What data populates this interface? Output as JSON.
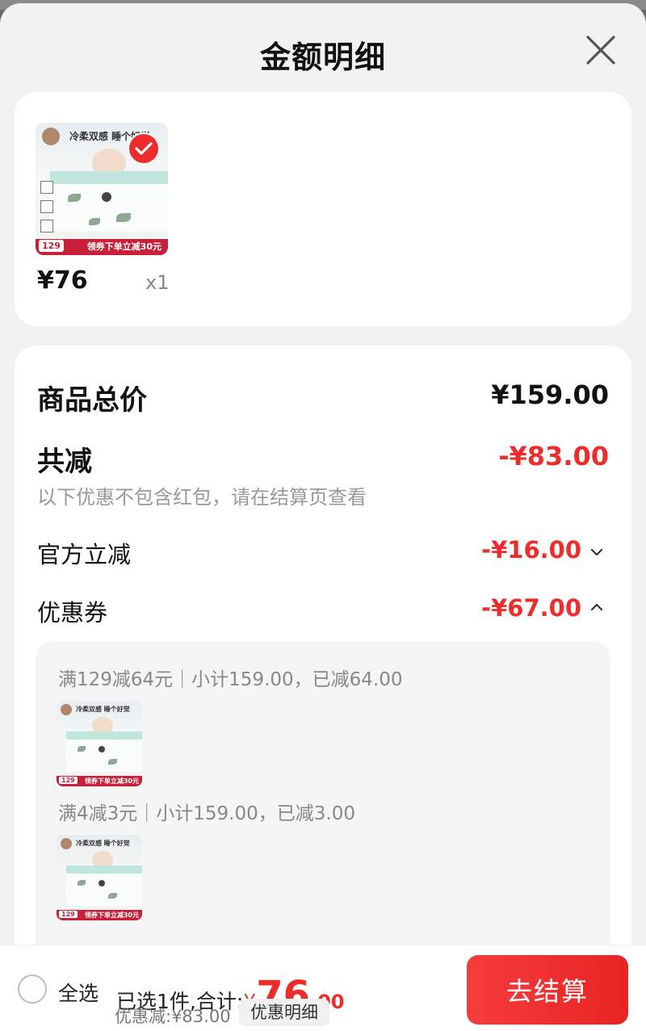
{
  "header": {
    "title": "金额明细"
  },
  "product": {
    "image_headline": "冷柔双感 睡个好觉",
    "image_promo": "领券下单立减30元",
    "image_price": "129",
    "price": "¥76",
    "quantity": "x1"
  },
  "summary_rows": {
    "total_label": "商品总价",
    "total_value": "¥159.00",
    "reduce_label": "共减",
    "reduce_value": "-¥83.00",
    "reduce_note": "以下优惠不包含红包，请在结算页查看",
    "official_label": "官方立减",
    "official_value": "-¥16.00",
    "coupon_label": "优惠券",
    "coupon_value": "-¥67.00"
  },
  "coupon_groups": [
    {
      "text": "满129减64元｜小计159.00，已减64.00"
    },
    {
      "text": "满4减3元｜小计159.00，已减3.00"
    }
  ],
  "bottom_bar": {
    "select_all": "全选",
    "selected_prefix": "已选1件,合计:",
    "currency": "¥",
    "total_int": "76",
    "total_dec": ".00",
    "discount_text": "优惠减:¥83.00",
    "detail_chip": "优惠明细",
    "checkout": "去结算"
  },
  "colors": {
    "accent_red": "#ee2c2c",
    "sheet_bg": "#f2f2f2",
    "overlay": "#6b6b6b"
  }
}
